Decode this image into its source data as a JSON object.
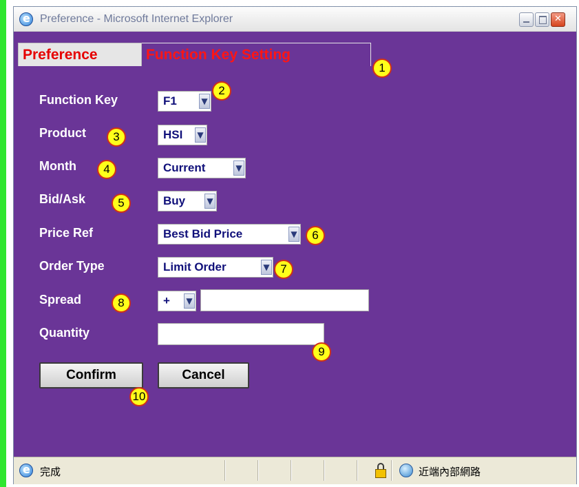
{
  "window": {
    "title": "Preference - Microsoft Internet Explorer"
  },
  "tabs": [
    {
      "label": "Preference"
    },
    {
      "label": "Function Key Setting"
    }
  ],
  "form": {
    "function_key": {
      "label": "Function Key",
      "value": "F1"
    },
    "product": {
      "label": "Product",
      "value": "HSI"
    },
    "month": {
      "label": "Month",
      "value": "Current"
    },
    "bid_ask": {
      "label": "Bid/Ask",
      "value": "Buy"
    },
    "price_ref": {
      "label": "Price Ref",
      "value": "Best Bid Price"
    },
    "order_type": {
      "label": "Order Type",
      "value": "Limit Order"
    },
    "spread": {
      "label": "Spread",
      "sign": "+",
      "value": ""
    },
    "quantity": {
      "label": "Quantity",
      "value": ""
    }
  },
  "buttons": {
    "confirm": "Confirm",
    "cancel": "Cancel"
  },
  "annotations": [
    "1",
    "2",
    "3",
    "4",
    "5",
    "6",
    "7",
    "8",
    "9",
    "10"
  ],
  "annotation_colors": {
    "fill": "#ffff1a",
    "border": "#d03018"
  },
  "status": {
    "text": "完成",
    "zone": "近端內部網路"
  },
  "colors": {
    "content_bg": "#6a3597",
    "tab_text": "#e60000",
    "label_text": "#ffffff",
    "select_text": "#10107a",
    "left_bar": "#2fe62f"
  }
}
